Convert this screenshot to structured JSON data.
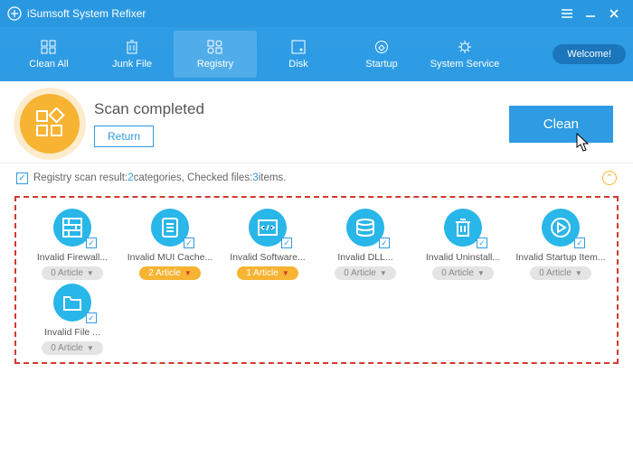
{
  "app": {
    "title": "iSumsoft System Refixer"
  },
  "nav": {
    "items": [
      {
        "label": "Clean All"
      },
      {
        "label": "Junk File"
      },
      {
        "label": "Registry"
      },
      {
        "label": "Disk"
      },
      {
        "label": "Startup"
      },
      {
        "label": "System Service"
      }
    ],
    "welcome": "Welcome!"
  },
  "header": {
    "title": "Scan completed",
    "return": "Return",
    "clean": "Clean"
  },
  "result": {
    "prefix": "Registry scan result: ",
    "cat_count": "2",
    "cat_label": " categories, Checked files: ",
    "item_count": "3",
    "item_label": " items."
  },
  "cells": [
    {
      "label": "Invalid Firewall...",
      "pill": "0 Article",
      "style": "gray",
      "icon": "firewall"
    },
    {
      "label": "Invalid MUI Cache...",
      "pill": "2 Article",
      "style": "orange",
      "icon": "doc"
    },
    {
      "label": "Invalid Software...",
      "pill": "1 Article",
      "style": "orange",
      "icon": "code"
    },
    {
      "label": "Invalid DLL...",
      "pill": "0 Article",
      "style": "gray",
      "icon": "stack"
    },
    {
      "label": "Invalid Uninstall...",
      "pill": "0 Article",
      "style": "gray",
      "icon": "trash"
    },
    {
      "label": "Invalid Startup Item...",
      "pill": "0 Article",
      "style": "gray",
      "icon": "play"
    },
    {
      "label": "Invalid File ...",
      "pill": "0 Article",
      "style": "gray",
      "icon": "folder"
    }
  ]
}
